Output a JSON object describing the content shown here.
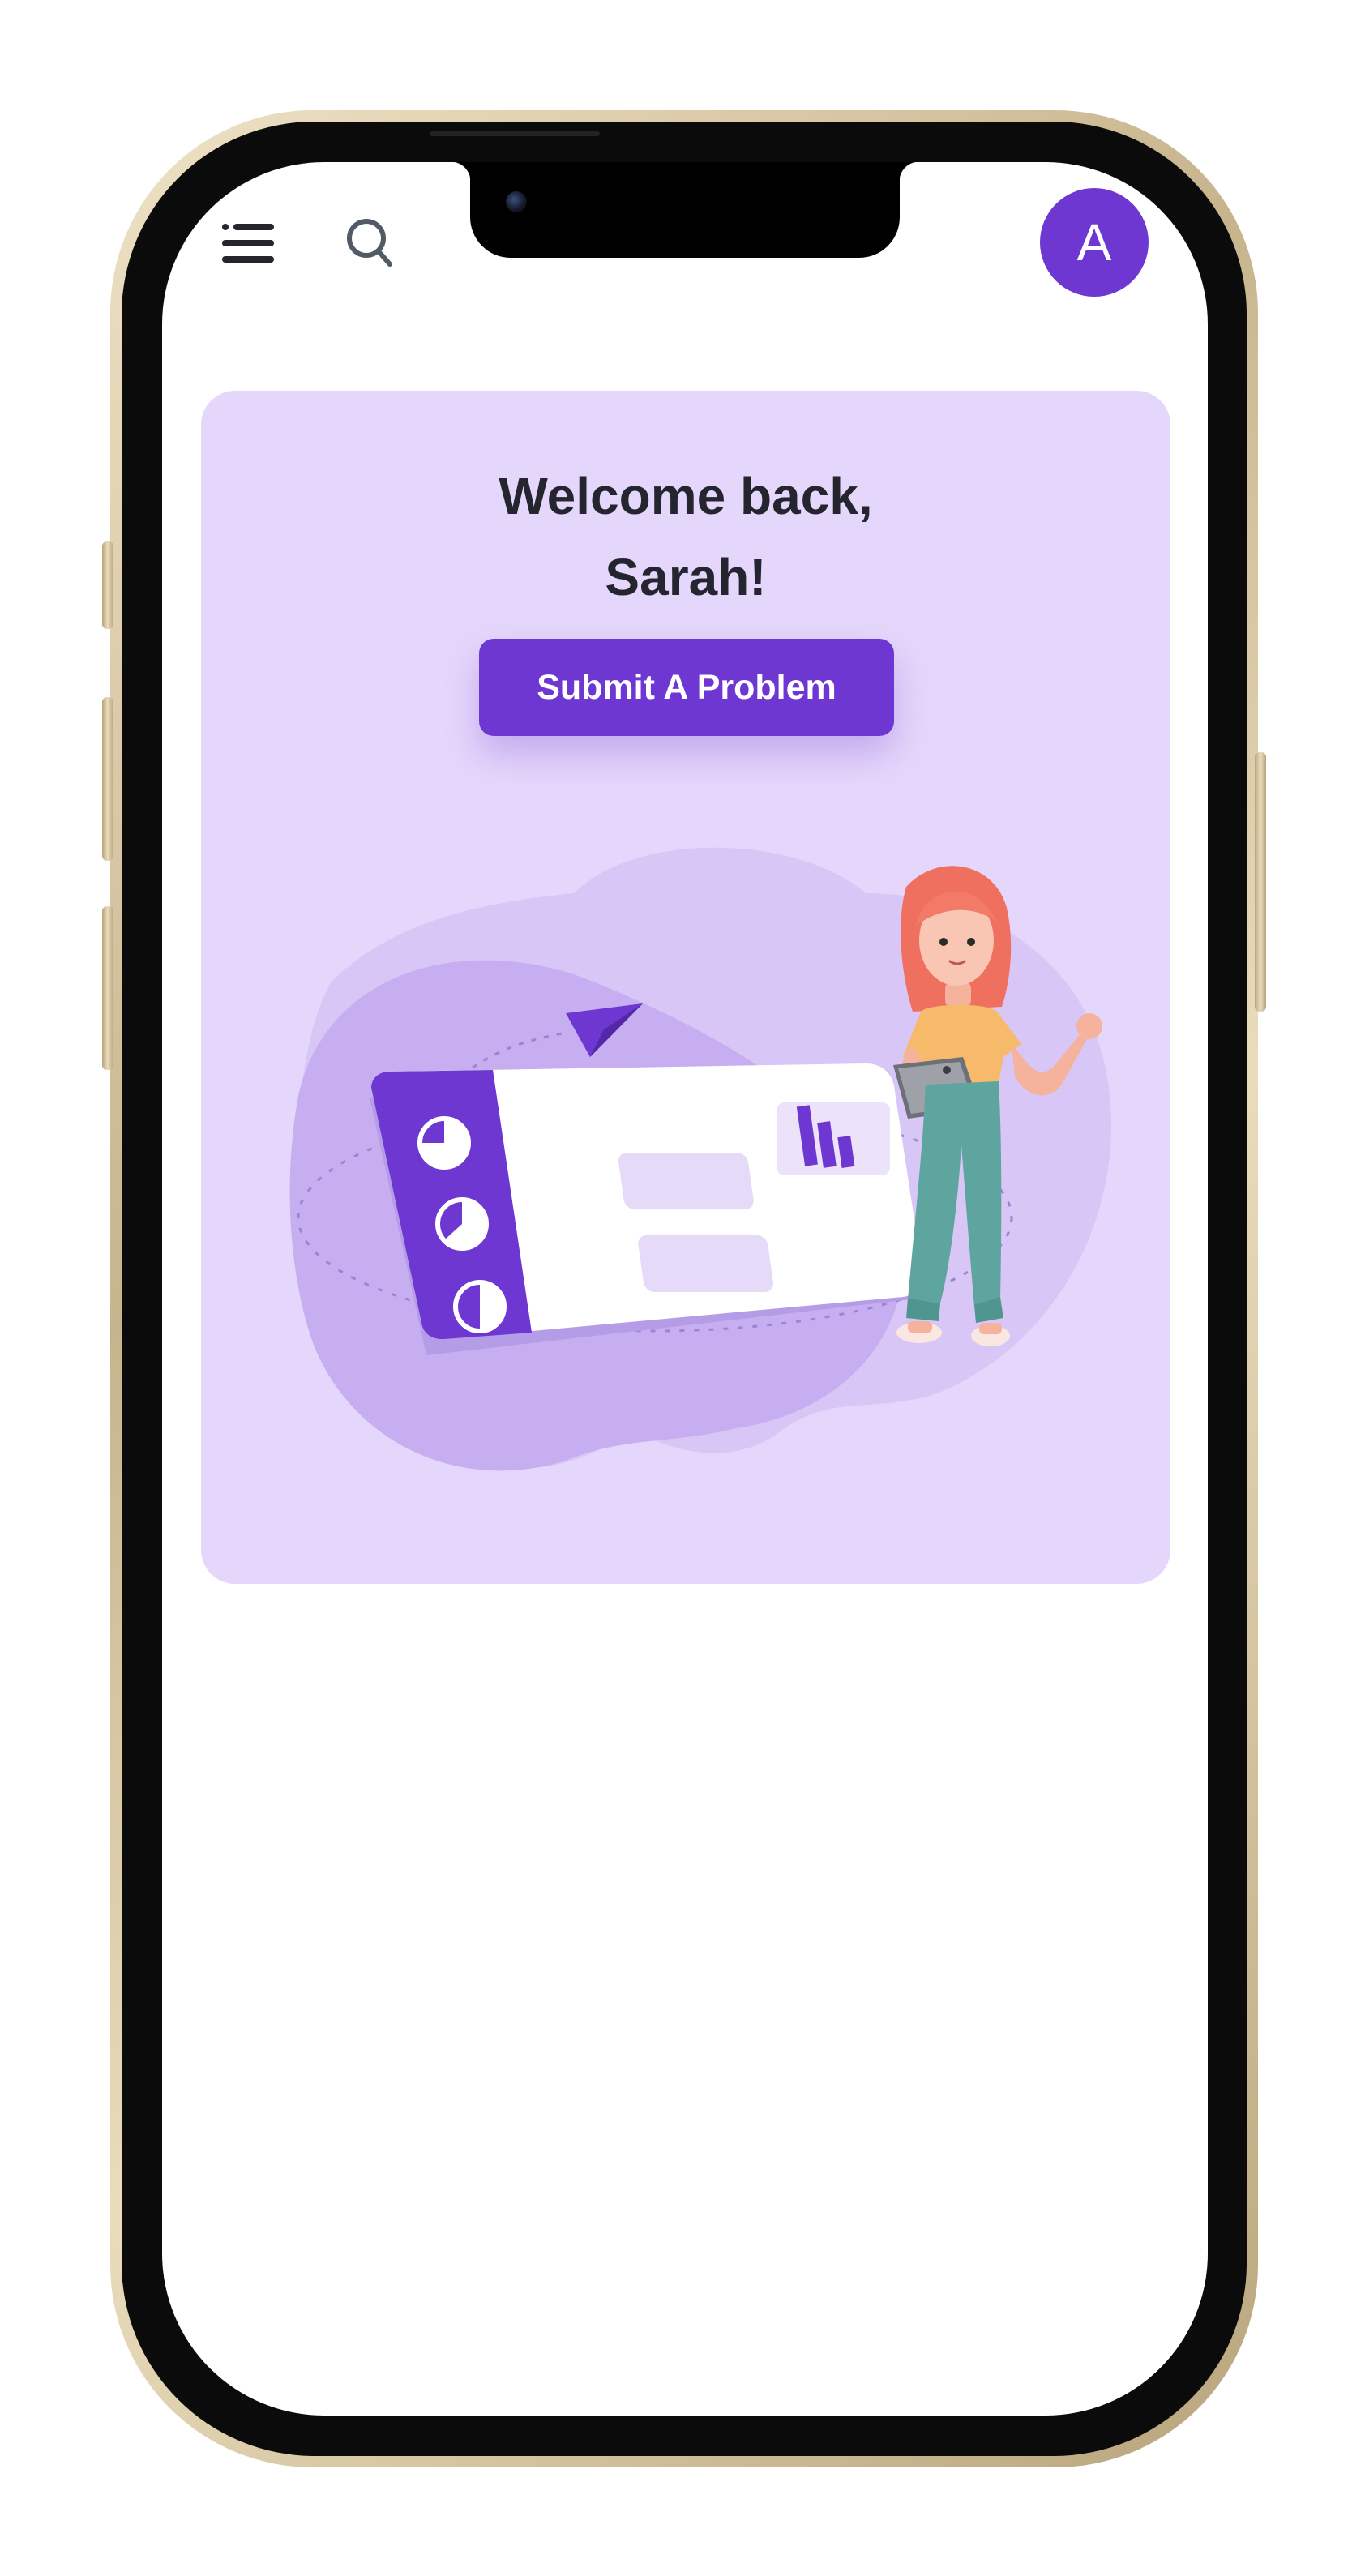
{
  "header": {
    "avatar_initial": "A",
    "menu_icon": "hamburger-menu-icon",
    "search_icon": "search-icon"
  },
  "welcome": {
    "line1": "Welcome back,",
    "line2": "Sarah!",
    "submit_label": "Submit A Problem"
  },
  "colors": {
    "accent": "#6e37d2",
    "card_bg": "#e5d7fb",
    "title_text": "#24252f",
    "screen_bg": "#ffffff"
  },
  "illustration": {
    "name": "woman-with-tablet-dashboard-illustration"
  }
}
